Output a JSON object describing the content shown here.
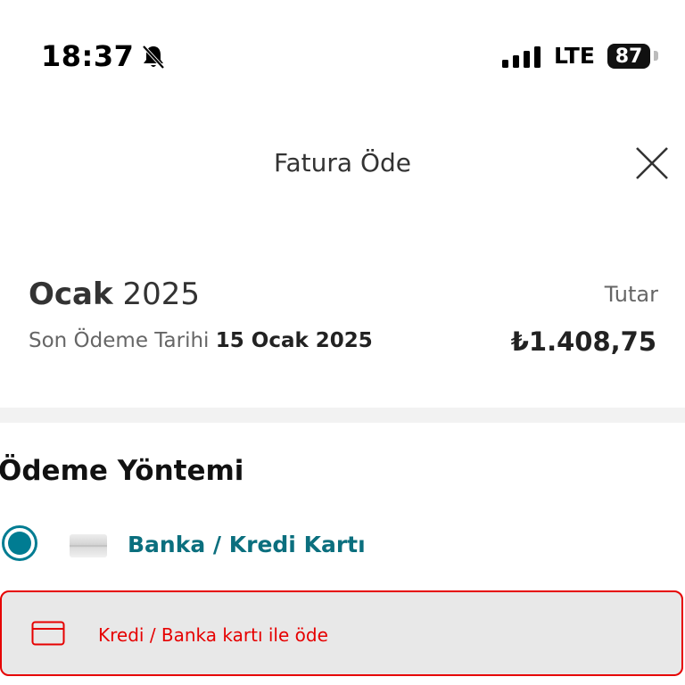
{
  "status_bar": {
    "time": "18:37",
    "network": "LTE",
    "battery": "87",
    "icons": [
      "bell-slash-icon",
      "signal-icon"
    ]
  },
  "header": {
    "title": "Fatura Öde",
    "close_icon": "close-icon"
  },
  "bill": {
    "month": "Ocak",
    "year": "2025",
    "due_label": "Son Ödeme Tarihi",
    "due_date": "15 Ocak 2025",
    "amount_label": "Tutar",
    "amount": "₺1.408,75"
  },
  "payment": {
    "section_title": "Ödeme Yöntemi",
    "method_label": "Banka / Kredi Kartı",
    "method_selected": true,
    "card_button_label": "Kredi / Banka kartı ile öde"
  },
  "colors": {
    "accent_teal": "#007c92",
    "brand_red": "#e60000",
    "divider_gray": "#f2f2f2"
  }
}
